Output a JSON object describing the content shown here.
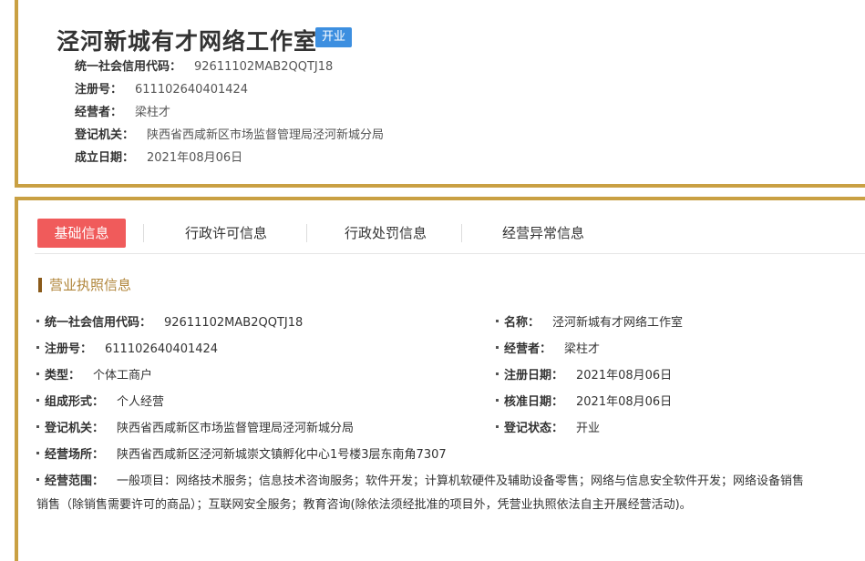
{
  "header": {
    "company_name": "泾河新城有才网络工作室",
    "status": "开业",
    "credit_code_label": "统一社会信用代码：",
    "credit_code": "92611102MAB2QQTJ18",
    "reg_no_label": "注册号：",
    "reg_no": "611102640401424",
    "operator_label": "经营者：",
    "operator": "梁柱才",
    "authority_label": "登记机关：",
    "authority": "陕西省西咸新区市场监督管理局泾河新城分局",
    "founded_label": "成立日期：",
    "founded": "2021年08月06日"
  },
  "tabs": [
    "基础信息",
    "行政许可信息",
    "行政处罚信息",
    "经营异常信息"
  ],
  "section": {
    "title": "营业执照信息"
  },
  "fields": {
    "credit_code": {
      "label": "统一社会信用代码：",
      "value": "92611102MAB2QQTJ18"
    },
    "name": {
      "label": "名称：",
      "value": "泾河新城有才网络工作室"
    },
    "reg_no": {
      "label": "注册号：",
      "value": "611102640401424"
    },
    "operator": {
      "label": "经营者：",
      "value": "梁柱才"
    },
    "type": {
      "label": "类型：",
      "value": "个体工商户"
    },
    "reg_date": {
      "label": "注册日期：",
      "value": "2021年08月06日"
    },
    "form": {
      "label": "组成形式：",
      "value": "个人经营"
    },
    "approve_date": {
      "label": "核准日期：",
      "value": "2021年08月06日"
    },
    "authority": {
      "label": "登记机关：",
      "value": "陕西省西咸新区市场监督管理局泾河新城分局"
    },
    "reg_status": {
      "label": "登记状态：",
      "value": "开业"
    },
    "address": {
      "label": "经营场所：",
      "value": "陕西省西咸新区泾河新城崇文镇孵化中心1号楼3层东南角7307"
    },
    "scope": {
      "label": "经营范围：",
      "value_line1": "一般项目：网络技术服务；信息技术咨询服务；软件开发；计算机软硬件及辅助设备零售；网络与信息安全软件开发；网络设备销售",
      "value_line2": "销售（除销售需要许可的商品）；互联网安全服务；教育咨询(除依法须经批准的项目外，凭营业执照依法自主开展经营活动)。"
    }
  }
}
